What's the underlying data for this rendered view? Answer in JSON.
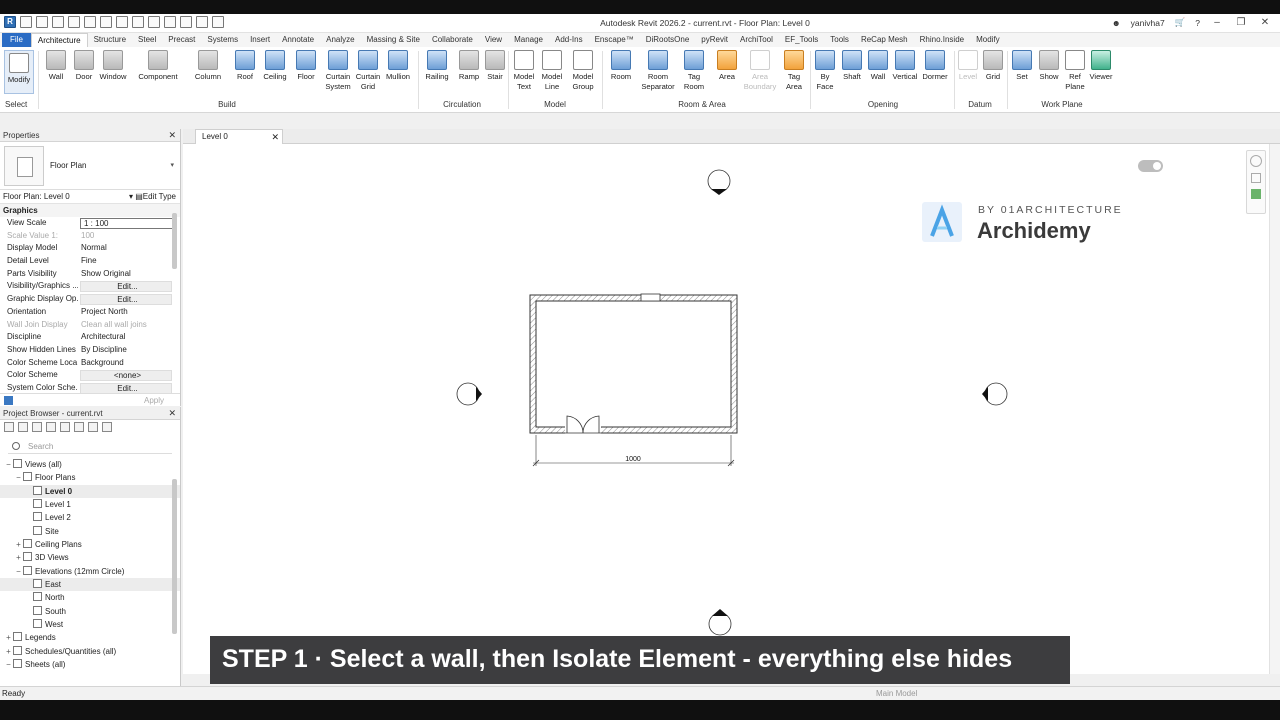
{
  "window": {
    "title": "Autodesk Revit 2026.2 - current.rvt - Floor Plan: Level 0",
    "user": "yanivha7"
  },
  "menu_tabs": [
    "File",
    "Architecture",
    "Structure",
    "Steel",
    "Precast",
    "Systems",
    "Insert",
    "Annotate",
    "Analyze",
    "Massing & Site",
    "Collaborate",
    "View",
    "Manage",
    "Add-Ins",
    "Enscape™",
    "DiRootsOne",
    "pyRevit",
    "ArchiTool",
    "EF_Tools",
    "Tools",
    "ReCap Mesh",
    "Rhino.Inside",
    "Modify"
  ],
  "ribbon": {
    "select_label": "Select",
    "buttons": [
      "Modify",
      "Wall",
      "Door",
      "Window",
      "Component",
      "Column",
      "Roof",
      "Ceiling",
      "Floor",
      "Curtain\nSystem",
      "Curtain\nGrid",
      "Mullion",
      "Railing",
      "Ramp",
      "Stair",
      "Model\nText",
      "Model\nLine",
      "Model\nGroup",
      "Room",
      "Room\nSeparator",
      "Tag\nRoom",
      "Area",
      "Area\nBoundary",
      "Tag\nArea",
      "By\nFace",
      "Shaft",
      "Wall",
      "Vertical",
      "Dormer",
      "Level",
      "Grid",
      "Set",
      "Show",
      "Ref\nPlane",
      "Viewer"
    ],
    "panels": [
      "Build",
      "Circulation",
      "Model",
      "Room & Area",
      "Opening",
      "Datum",
      "Work Plane"
    ]
  },
  "properties": {
    "header": "Properties",
    "type_name": "Floor Plan",
    "instance": "Floor Plan: Level 0",
    "edit_type": "Edit Type",
    "group": "Graphics",
    "rows": [
      {
        "k": "View Scale",
        "v": "1 : 100"
      },
      {
        "k": "Scale Value    1:",
        "v": "100"
      },
      {
        "k": "Display Model",
        "v": "Normal"
      },
      {
        "k": "Detail Level",
        "v": "Fine"
      },
      {
        "k": "Parts Visibility",
        "v": "Show Original"
      },
      {
        "k": "Visibility/Graphics ...",
        "v": "Edit..."
      },
      {
        "k": "Graphic Display Op...",
        "v": "Edit..."
      },
      {
        "k": "Orientation",
        "v": "Project North"
      },
      {
        "k": "Wall Join Display",
        "v": "Clean all wall joins"
      },
      {
        "k": "Discipline",
        "v": "Architectural"
      },
      {
        "k": "Show Hidden Lines",
        "v": "By Discipline"
      },
      {
        "k": "Color Scheme Loca...",
        "v": "Background"
      },
      {
        "k": "Color Scheme",
        "v": "<none>"
      },
      {
        "k": "System Color Sche...",
        "v": "Edit..."
      }
    ],
    "apply": "Apply"
  },
  "browser": {
    "header": "Project Browser - current.rvt",
    "search_placeholder": "Search",
    "nodes": [
      {
        "label": "Views (all)",
        "toggle": "−",
        "indent": 0
      },
      {
        "label": "Floor Plans",
        "toggle": "−",
        "indent": 1
      },
      {
        "label": "Level 0",
        "indent": 2,
        "view": true
      },
      {
        "label": "Level 1",
        "indent": 2,
        "view": true
      },
      {
        "label": "Level 2",
        "indent": 2,
        "view": true
      },
      {
        "label": "Site",
        "indent": 2,
        "view": true
      },
      {
        "label": "Ceiling Plans",
        "toggle": "+",
        "indent": 1
      },
      {
        "label": "3D Views",
        "toggle": "+",
        "indent": 1
      },
      {
        "label": "Elevations (12mm Circle)",
        "toggle": "−",
        "indent": 1
      },
      {
        "label": "East",
        "indent": 2,
        "view": true
      },
      {
        "label": "North",
        "indent": 2,
        "view": true
      },
      {
        "label": "South",
        "indent": 2,
        "view": true
      },
      {
        "label": "West",
        "indent": 2,
        "view": true
      },
      {
        "label": "Legends",
        "toggle": "+",
        "indent": 0
      },
      {
        "label": "Schedules/Quantities (all)",
        "toggle": "+",
        "indent": 0
      },
      {
        "label": "Sheets (all)",
        "toggle": "−",
        "indent": 0
      }
    ]
  },
  "view_tab": "Level 0",
  "drawing": {
    "dimension": "1000",
    "scale_hint": "1 :"
  },
  "logo": {
    "by": "BY 01ARCHITECTURE",
    "name": "Archidemy"
  },
  "caption": "STEP 1  ·  Select a wall, then Isolate Element - everything else hides",
  "status": {
    "ready": "Ready",
    "model": "Main Model"
  }
}
